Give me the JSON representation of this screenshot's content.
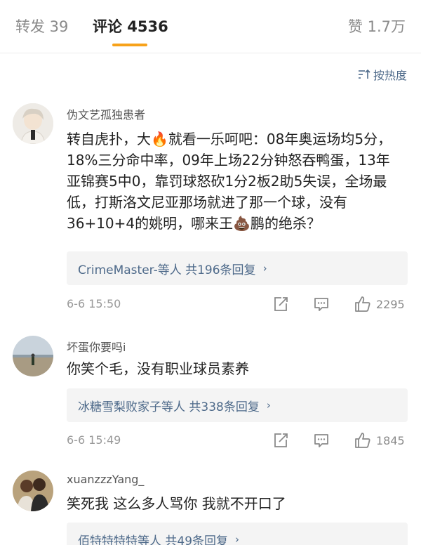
{
  "tabs": {
    "reposts": "转发 39",
    "comments": "评论 4536",
    "likes": "赞 1.7万"
  },
  "sort": {
    "label": "按热度",
    "icon": "sort-icon"
  },
  "comments": [
    {
      "username": "伪文艺孤独患者",
      "text": "转自虎扑，大🔥就看一乐呵吧：08年奥运场均5分，18%三分命中率，09年上场22分钟怒吞鸭蛋，13年亚锦赛5中0，靠罚球怒砍1分2板2助5失误，全场最低，打斯洛文尼亚那场就进了那一个球，没有36+10+4的姚明，哪来王💩鹏的绝杀？",
      "replies": "CrimeMaster-等人  共196条回复",
      "time": "6-6 15:50",
      "likes": "2295"
    },
    {
      "username": "坏蛋你要吗i",
      "text": "你笑个毛，没有职业球员素养",
      "replies": "冰糖雪梨败家子等人  共338条回复",
      "time": "6-6 15:49",
      "likes": "1845"
    },
    {
      "username": "xuanzzzYang_",
      "text": "笑死我 这么多人骂你 我就不开口了",
      "replies": "佰特特特特等人  共49条回复",
      "time": "",
      "likes": ""
    }
  ],
  "colors": {
    "accent": "#f7a21a",
    "link": "#4e6a8a",
    "muted": "#9a9a9a"
  }
}
